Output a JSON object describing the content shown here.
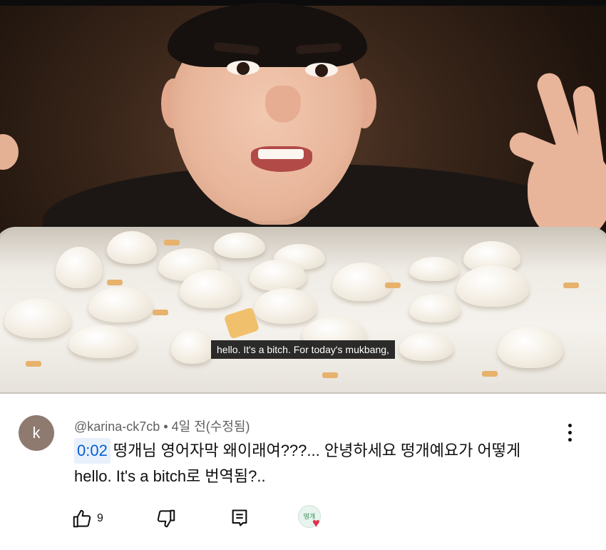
{
  "video": {
    "subtitle": "hello. It's a bitch. For today's mukbang,"
  },
  "comment": {
    "avatar_letter": "k",
    "author": "@karina-ck7cb",
    "separator": "•",
    "time": "4일 전(수정됨)",
    "timestamp_link": "0:02",
    "text_line1": "떵개님 영어자막 왜이래여???... 안녕하세요 떵개예요가 어떻게",
    "text_line2": "hello. It's a bitch로 번역됨?..",
    "like_count": "9",
    "creator_heart": true
  },
  "icons": {
    "like": "thumbs-up-icon",
    "dislike": "thumbs-down-icon",
    "reply": "reply-icon",
    "more": "more-vertical-icon",
    "heart": "heart-icon"
  },
  "colors": {
    "timestamp_link": "#065fd4",
    "heart": "#e0304b",
    "meta_text": "#606060"
  }
}
